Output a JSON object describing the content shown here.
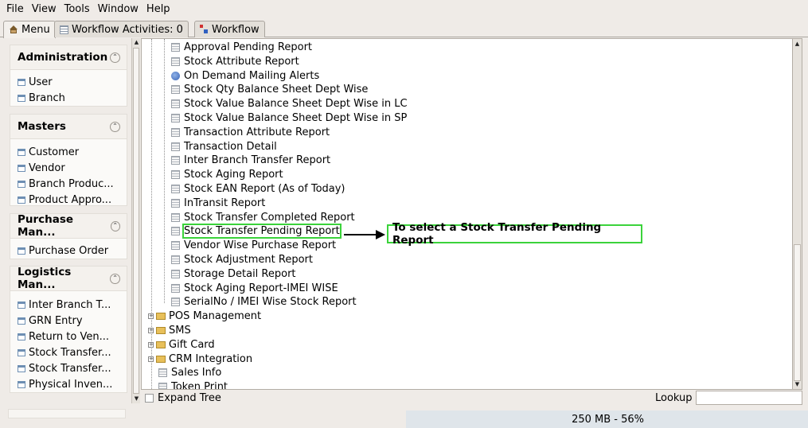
{
  "menubar": [
    "File",
    "View",
    "Tools",
    "Window",
    "Help"
  ],
  "tabs": {
    "menu": "Menu",
    "activities": "Workflow Activities: 0",
    "workflow": "Workflow"
  },
  "sidebar": {
    "groups": [
      {
        "title": "Administration",
        "items": [
          "User",
          "Branch"
        ]
      },
      {
        "title": "Masters",
        "items": [
          "Customer",
          "Vendor",
          "Branch Produc...",
          "Product Appro..."
        ]
      },
      {
        "title": "Purchase Man...",
        "items": [
          "Purchase Order"
        ]
      },
      {
        "title": "Logistics Man...",
        "items": [
          "Inter Branch T...",
          "GRN Entry",
          "Return to Ven...",
          "Stock Transfer...",
          "Stock Transfer...",
          "Physical Inven..."
        ]
      }
    ]
  },
  "tree": {
    "reports": [
      "Approval Pending Report",
      "Stock Attribute Report",
      "On Demand Mailing Alerts",
      "Stock Qty Balance Sheet Dept Wise",
      "Stock Value Balance Sheet Dept Wise in LC",
      "Stock Value Balance Sheet Dept Wise in SP",
      "Transaction Attribute Report",
      "Transaction Detail",
      "Inter Branch Transfer Report",
      "Stock Aging Report",
      "Stock EAN Report (As of Today)",
      "InTransit Report",
      "Stock Transfer Completed Report",
      "Stock Transfer Pending Report",
      "Vendor Wise Purchase Report",
      "Stock Adjustment Report",
      "Storage Detail Report",
      "Stock Aging Report-IMEI WISE",
      "SerialNo / IMEI Wise Stock Report"
    ],
    "folders": [
      "POS Management",
      "SMS",
      "Gift Card",
      "CRM Integration"
    ],
    "bottom_leaves": [
      "Sales Info",
      "Token Print"
    ]
  },
  "annotation": "To select a Stock Transfer Pending Report",
  "bottombar": {
    "expand_tree": "Expand Tree",
    "lookup": "Lookup"
  },
  "status": {
    "memory": "250 MB - 56%"
  },
  "colors": {
    "highlight": "#3bd33b",
    "memory_bar": "#dfe5ea"
  }
}
